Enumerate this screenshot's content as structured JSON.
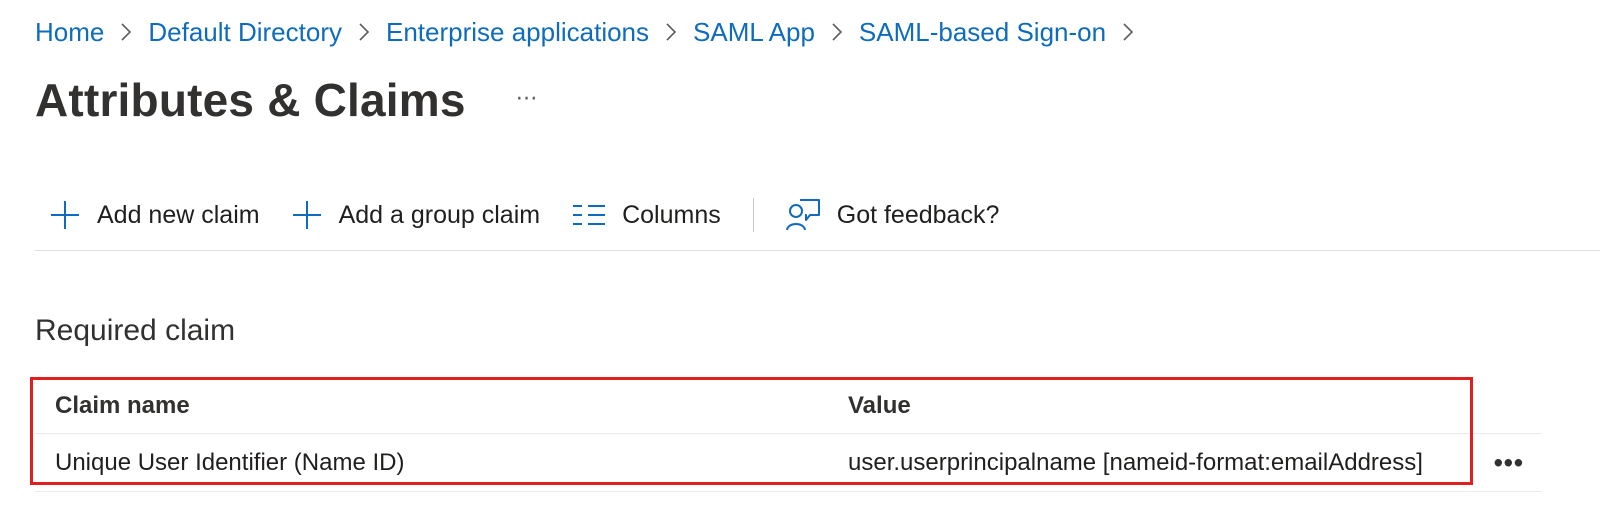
{
  "breadcrumb": [
    {
      "label": "Home"
    },
    {
      "label": "Default Directory"
    },
    {
      "label": "Enterprise applications"
    },
    {
      "label": "SAML App"
    },
    {
      "label": "SAML-based Sign-on"
    }
  ],
  "page": {
    "title": "Attributes & Claims",
    "more_label": "⋯"
  },
  "toolbar": {
    "add_claim_label": "Add new claim",
    "add_group_claim_label": "Add a group claim",
    "columns_label": "Columns",
    "feedback_label": "Got feedback?"
  },
  "required_claim": {
    "section_title": "Required claim",
    "columns": [
      "Claim name",
      "Value"
    ],
    "rows": [
      {
        "claim_name": "Unique User Identifier (Name ID)",
        "value": "user.userprincipalname [nameid-format:emailAddress]",
        "more_label": "•••"
      }
    ]
  },
  "colors": {
    "link": "#0f6cbd",
    "highlight": "#e02020",
    "text": "#201f1e"
  },
  "icons": [
    "chevron-right-icon",
    "plus-icon",
    "columns-icon",
    "feedback-icon"
  ]
}
